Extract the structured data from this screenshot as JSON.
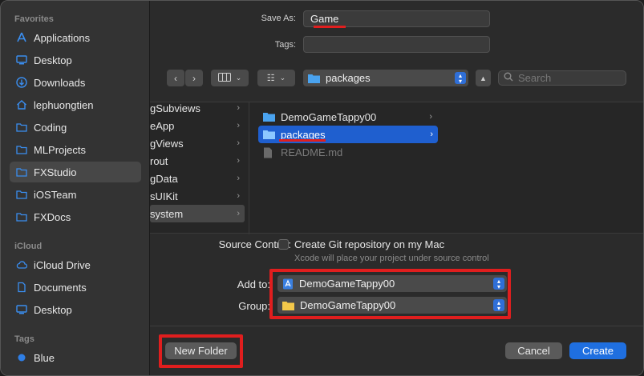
{
  "sidebar": {
    "favorites_heading": "Favorites",
    "favorites": [
      {
        "label": "Applications",
        "icon": "applications-icon"
      },
      {
        "label": "Desktop",
        "icon": "desktop-icon"
      },
      {
        "label": "Downloads",
        "icon": "downloads-icon"
      },
      {
        "label": "lephuongtien",
        "icon": "home-icon"
      },
      {
        "label": "Coding",
        "icon": "folder-icon"
      },
      {
        "label": "MLProjects",
        "icon": "folder-icon"
      },
      {
        "label": "FXStudio",
        "icon": "folder-icon",
        "selected": true
      },
      {
        "label": "iOSTeam",
        "icon": "folder-icon"
      },
      {
        "label": "FXDocs",
        "icon": "folder-icon"
      }
    ],
    "icloud_heading": "iCloud",
    "icloud": [
      {
        "label": "iCloud Drive",
        "icon": "cloud-icon"
      },
      {
        "label": "Documents",
        "icon": "document-icon"
      },
      {
        "label": "Desktop",
        "icon": "desktop-icon"
      }
    ],
    "tags_heading": "Tags",
    "tags": [
      {
        "label": "Blue",
        "color": "#2f7fe6"
      }
    ]
  },
  "save_as": {
    "label": "Save As:",
    "value": "Game"
  },
  "tags_field": {
    "label": "Tags:",
    "value": ""
  },
  "toolbar": {
    "location": "packages",
    "search_placeholder": "Search"
  },
  "browser": {
    "column1": [
      "gSubviews",
      "eApp",
      "gViews",
      "rout",
      "gData",
      "sUIKit",
      "system"
    ],
    "column2": [
      {
        "label": "DemoGameTappy00",
        "type": "folder"
      },
      {
        "label": "packages",
        "type": "folder",
        "selected": true
      },
      {
        "label": "README.md",
        "type": "file",
        "dim": true
      }
    ]
  },
  "options": {
    "source_control_label": "Source Control:",
    "git_checkbox_label": "Create Git repository on my Mac",
    "git_hint": "Xcode will place your project under source control",
    "add_to_label": "Add to:",
    "add_to_value": "DemoGameTappy00",
    "group_label": "Group:",
    "group_value": "DemoGameTappy00"
  },
  "footer": {
    "new_folder": "New Folder",
    "cancel": "Cancel",
    "create": "Create"
  },
  "colors": {
    "accent": "#1f6fe0",
    "annotation": "#e01e1e"
  }
}
